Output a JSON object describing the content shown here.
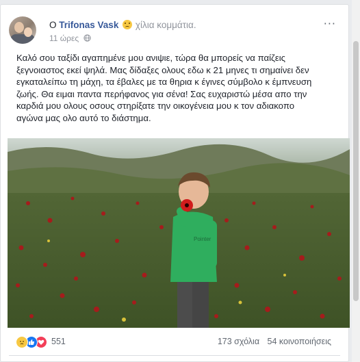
{
  "post": {
    "author_prefix": "Ο",
    "author_name": "Trifonas Vask",
    "feeling_emoji": "sad-emoji",
    "feeling_text": "χίλια κομμάτια.",
    "timestamp": "11 ώρες",
    "audience_icon": "globe-icon",
    "more_icon": "more-options-icon",
    "text_lines": [
      "Καλό σου ταξίδι αγαπημένε μου ανιψιε, τώρα θα μπορείς να παίζεις",
      "ξεγνοιαστος εκεί ψηλά. Μας δίδαξες ολους εδω κ 21 μηνες τι σημαίνει δεν",
      "εγκαταλείπω τη μάχη, τα έβαλες με τα θηρια κ έγινες σύμβολο κ έμπνευση",
      "ζωής. Θα ειμαι παντα περήφανος για σένα! Σας ευχαριστώ μέσα απο την",
      "καρδιά μου ολους οσους στηρίξατε την οικογένεια μου κ τον αδιακοπο",
      "αγώνα μας ολο αυτό το διάστημα."
    ]
  },
  "image": {
    "shirt_text": "Pointer",
    "description_icon": "child-holding-poppy-photo"
  },
  "reactions": {
    "icons": [
      "sad-reaction-icon",
      "like-reaction-icon",
      "love-reaction-icon"
    ],
    "total": "551",
    "comments": "173 σχόλια",
    "shares": "54 κοινοποιήσεις"
  },
  "colors": {
    "link": "#365899",
    "meta": "#90949c",
    "text": "#1d2129",
    "background": "#e9ebee"
  }
}
